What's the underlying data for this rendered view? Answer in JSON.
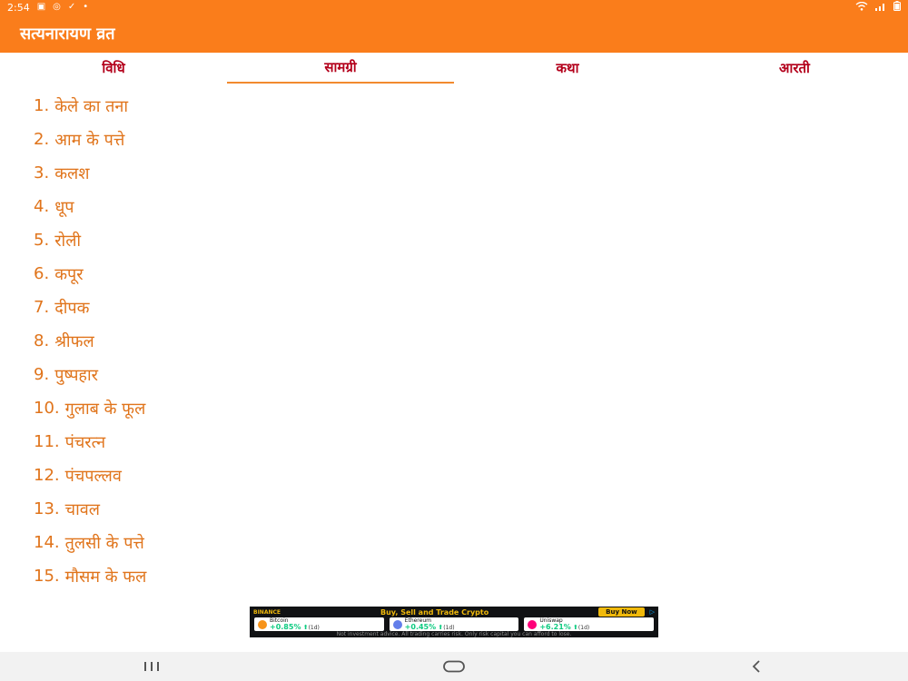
{
  "status_bar": {
    "time": "2:54",
    "left_icons": [
      "image-icon",
      "sync-icon",
      "check-icon",
      "dot-icon"
    ],
    "right_icons": [
      "wifi-icon",
      "signal-icon",
      "battery-icon"
    ]
  },
  "app_bar": {
    "title": "सत्यनारायण व्रत"
  },
  "tabs": [
    {
      "label": "विधि",
      "active": false
    },
    {
      "label": "सामग्री",
      "active": true
    },
    {
      "label": "कथा",
      "active": false
    },
    {
      "label": "आरती",
      "active": false
    }
  ],
  "items": [
    {
      "num": "1.",
      "text": "केले का तना"
    },
    {
      "num": "2.",
      "text": "आम के पत्ते"
    },
    {
      "num": "3.",
      "text": "कलश"
    },
    {
      "num": "4.",
      "text": "धूप"
    },
    {
      "num": "5.",
      "text": "रोली"
    },
    {
      "num": "6.",
      "text": "कपूर"
    },
    {
      "num": "7.",
      "text": "दीपक"
    },
    {
      "num": "8.",
      "text": "श्रीफल"
    },
    {
      "num": "9.",
      "text": "पुष्पहार"
    },
    {
      "num": "10.",
      "text": "गुलाब के फूल"
    },
    {
      "num": "11.",
      "text": "पंचरत्न"
    },
    {
      "num": "12.",
      "text": "पंचपल्लव"
    },
    {
      "num": "13.",
      "text": "चावल"
    },
    {
      "num": "14.",
      "text": "तुलसी के पत्ते"
    },
    {
      "num": "15.",
      "text": "मौसम के फल"
    }
  ],
  "ad": {
    "brand": "BINANCE",
    "headline": "Buy, Sell and Trade Crypto",
    "cta": "Buy Now",
    "coins": [
      {
        "name": "Bitcoin",
        "change": "+0.85%",
        "period": "(1d)",
        "color": "#f7931a"
      },
      {
        "name": "Ethereum",
        "change": "+0.45%",
        "period": "(1d)",
        "color": "#627eea"
      },
      {
        "name": "Uniswap",
        "change": "+6.21%",
        "period": "(1d)",
        "color": "#ff007a"
      }
    ],
    "disclaimer": "Not investment advice. All trading carries risk. Only risk capital you can afford to lose."
  },
  "nav_bar": {
    "buttons": [
      "recents-icon",
      "home-icon",
      "back-icon"
    ]
  },
  "colors": {
    "accent": "#fa7d1b",
    "tab_text": "#b3001b",
    "item_text": "#e0741b"
  }
}
